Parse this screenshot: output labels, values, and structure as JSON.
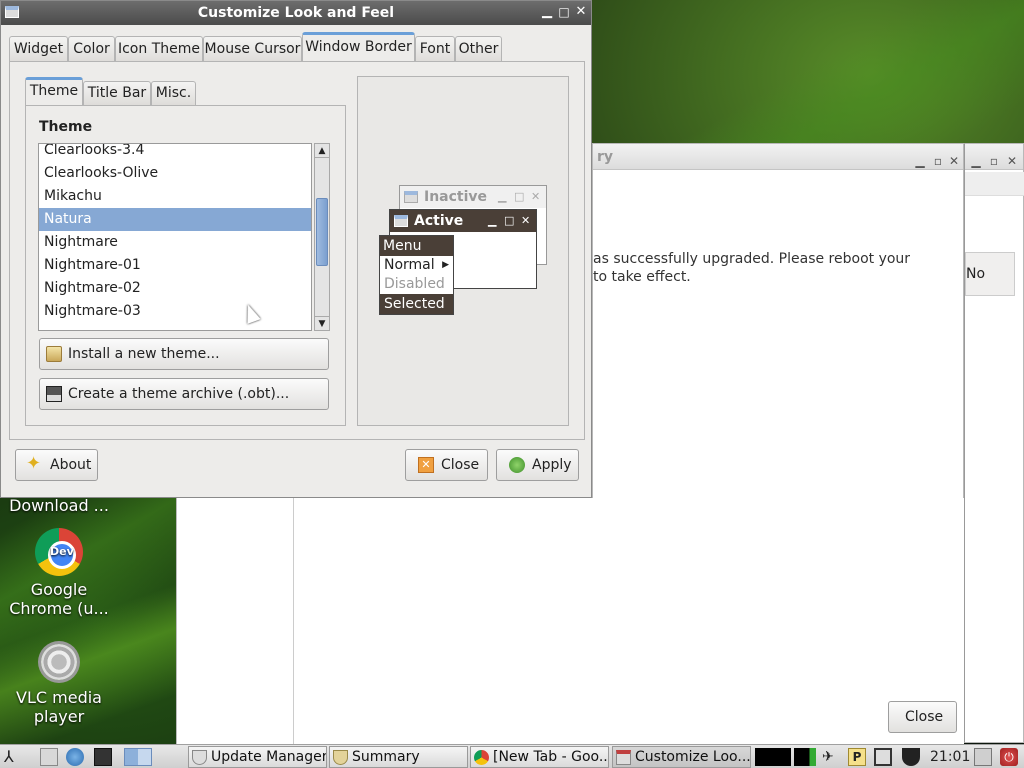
{
  "desktop": {
    "icons": [
      {
        "label": "Download ..."
      },
      {
        "label": "Google Chrome (u...",
        "badge": "Dev"
      },
      {
        "label": "VLC media player"
      }
    ]
  },
  "bg_window": {
    "title_fragment": "ry",
    "message_line1": "as successfully upgraded. Please reboot your",
    "message_line2": "to take effect.",
    "no_button": "No",
    "close_button": "Close"
  },
  "dialog": {
    "title": "Customize Look and Feel",
    "tabs": [
      "Widget",
      "Color",
      "Icon Theme",
      "Mouse Cursor",
      "Window Border",
      "Font",
      "Other"
    ],
    "active_tab": "Window Border",
    "subtabs": [
      "Theme",
      "Title Bar",
      "Misc."
    ],
    "section_heading": "Theme",
    "themes": [
      "Clearlooks-3.4",
      "Clearlooks-Olive",
      "Mikachu",
      "Natura",
      "Nightmare",
      "Nightmare-01",
      "Nightmare-02",
      "Nightmare-03"
    ],
    "selected_theme": "Natura",
    "install_button": "Install a new theme...",
    "archive_button": "Create a theme archive (.obt)...",
    "about_button": "About",
    "close_button": "Close",
    "apply_button": "Apply",
    "preview": {
      "inactive_title": "Inactive",
      "active_title": "Active",
      "menu_header": "Menu",
      "menu_items": [
        "Normal",
        "Disabled",
        "Selected"
      ]
    }
  },
  "taskbar": {
    "tasks": [
      "Update Manager",
      "Summary",
      "[New Tab - Goo...",
      "Customize Loo..."
    ],
    "clock": "21:01"
  },
  "colors": {
    "titlebar": "#4b4b4b",
    "selection": "#86a8d4",
    "preview_active": "#4a3f37",
    "tab_accent": "#6a9fd8"
  }
}
